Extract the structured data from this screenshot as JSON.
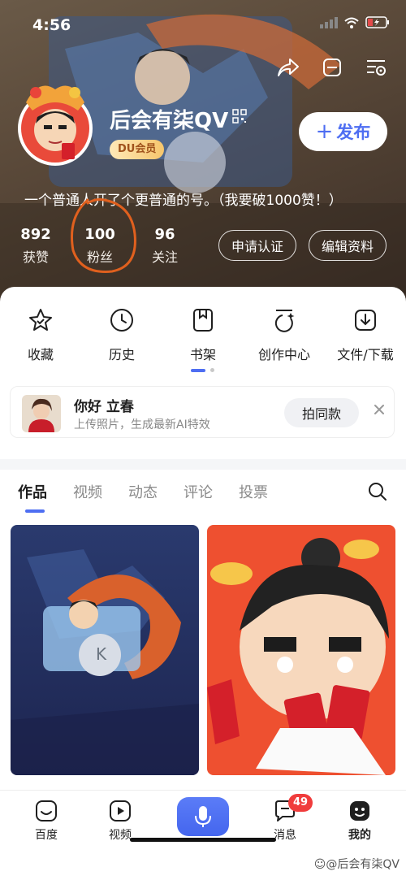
{
  "status_bar": {
    "time": "4:56"
  },
  "profile": {
    "username": "后会有柒QV",
    "membership_badge": "DU会员",
    "publish_label": "发布",
    "publish_symbol": "+",
    "bio": "一个普通人开了个更普通的号。（我要破1000赞！）",
    "stats": [
      {
        "value": "892",
        "label": "获赞"
      },
      {
        "value": "100",
        "label": "粉丝"
      },
      {
        "value": "96",
        "label": "关注"
      }
    ],
    "apply_verify_label": "申请认证",
    "edit_profile_label": "编辑资料"
  },
  "quick_access": [
    {
      "label": "收藏",
      "icon": "star-icon"
    },
    {
      "label": "历史",
      "icon": "clock-icon"
    },
    {
      "label": "书架",
      "icon": "bookshelf-icon"
    },
    {
      "label": "创作中心",
      "icon": "create-icon"
    },
    {
      "label": "文件/下载",
      "icon": "download-icon"
    }
  ],
  "promo": {
    "title": "你好 立春",
    "subtitle": "上传照片，生成最新AI特效",
    "button_label": "拍同款"
  },
  "tabs": [
    {
      "label": "作品",
      "active": true
    },
    {
      "label": "视频",
      "active": false
    },
    {
      "label": "动态",
      "active": false
    },
    {
      "label": "评论",
      "active": false
    },
    {
      "label": "投票",
      "active": false
    }
  ],
  "bottom_nav": {
    "items": [
      {
        "label": "百度",
        "icon": "baidu-home-icon"
      },
      {
        "label": "视频",
        "icon": "video-play-icon"
      },
      {
        "label": "消息",
        "icon": "message-icon",
        "badge": "49"
      },
      {
        "label": "我的",
        "icon": "profile-face-icon",
        "active": true
      }
    ],
    "watermark": "后会有柒QV",
    "watermark_prefix": "☺@"
  },
  "colors": {
    "accent": "#4e6ef2",
    "badge_red": "#f03c3c",
    "header_brown": "#5b4a3a"
  }
}
